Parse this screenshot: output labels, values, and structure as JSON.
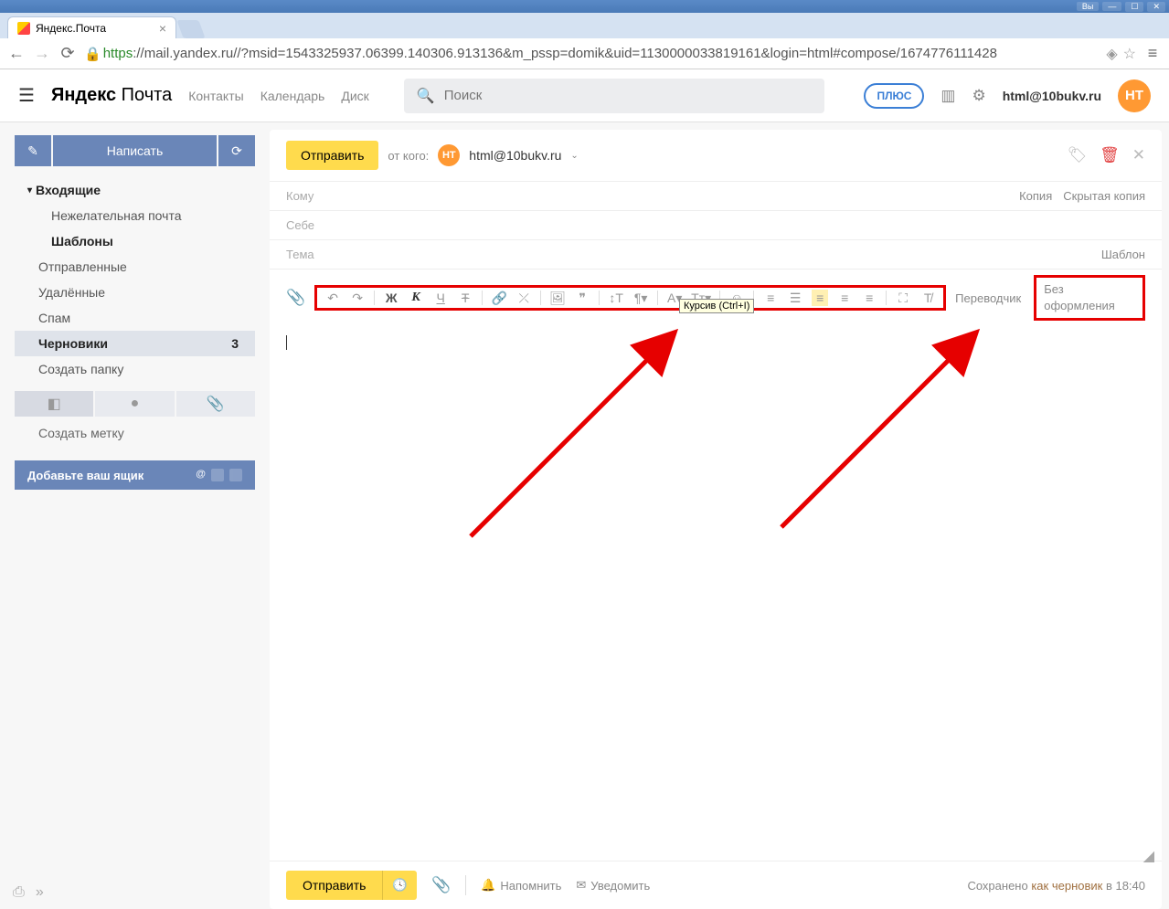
{
  "browser": {
    "user_btn": "Вы",
    "tab_title": "Яндекс.Почта",
    "url": "https://mail.yandex.ru//?msid=1543325937.06399.140306.913136&m_pssp=domik&uid=1130000033819161&login=html#compose/1674776111428"
  },
  "header": {
    "logo": "Яндекс",
    "logo_sub": "Почта",
    "nav": {
      "contacts": "Контакты",
      "calendar": "Календарь",
      "disk": "Диск"
    },
    "search_placeholder": "Поиск",
    "plus": "ПЛЮС",
    "user_email": "html@10bukv.ru",
    "avatar": "НТ"
  },
  "sidebar": {
    "compose": "Написать",
    "folders": {
      "inbox": "Входящие",
      "spam_folder": "Нежелательная почта",
      "templates": "Шаблоны",
      "sent": "Отправленные",
      "deleted": "Удалённые",
      "spam": "Спам",
      "drafts": "Черновики",
      "drafts_count": "3",
      "create_folder": "Создать папку"
    },
    "create_label": "Создать метку",
    "add_mailbox": "Добавьте ваш ящик"
  },
  "compose": {
    "send": "Отправить",
    "from_label": "от кого:",
    "from_email": "html@10bukv.ru",
    "to_label": "Кому",
    "cc": "Копия",
    "bcc": "Скрытая копия",
    "self_label": "Себе",
    "subject_label": "Тема",
    "template": "Шаблон",
    "translator": "Переводчик",
    "no_format": "Без оформления",
    "tooltip": "Курсив (Ctrl+I)",
    "remind": "Напомнить",
    "notify": "Уведомить",
    "saved_prefix": "Сохранено ",
    "saved_link": "как черновик",
    "saved_time": " в 18:40"
  }
}
